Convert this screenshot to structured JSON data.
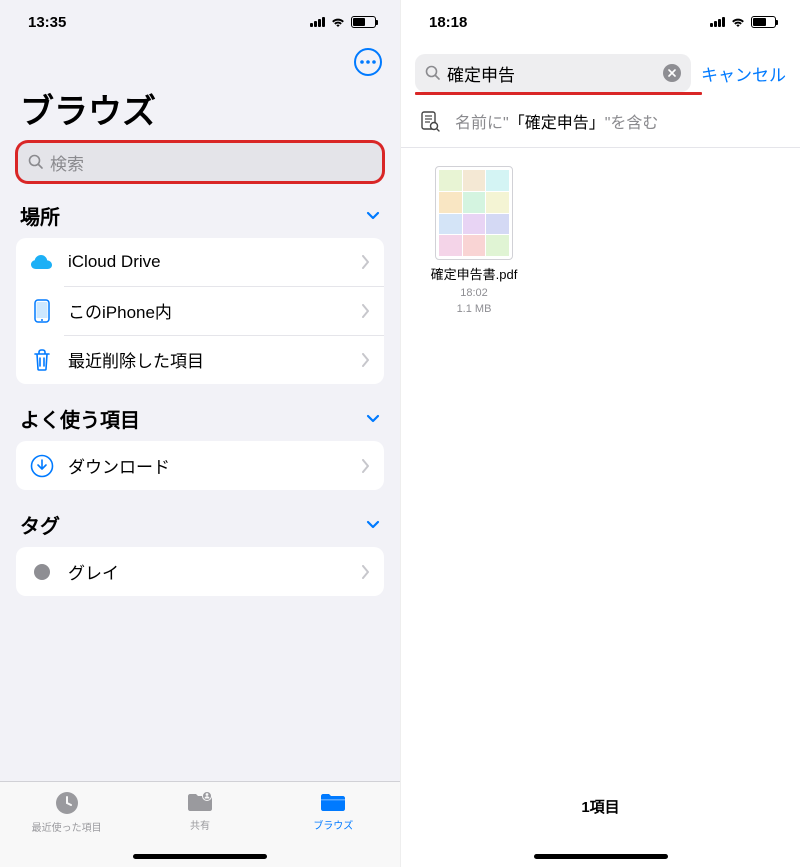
{
  "left": {
    "status_time": "13:35",
    "battery_percent": 55,
    "title": "ブラウズ",
    "search_placeholder": "検索",
    "sections": {
      "locations": {
        "title": "場所",
        "items": [
          {
            "label": "iCloud Drive",
            "icon": "cloud"
          },
          {
            "label": "このiPhone内",
            "icon": "phone"
          },
          {
            "label": "最近削除した項目",
            "icon": "trash"
          }
        ]
      },
      "favorites": {
        "title": "よく使う項目",
        "items": [
          {
            "label": "ダウンロード",
            "icon": "download"
          }
        ]
      },
      "tags": {
        "title": "タグ",
        "items": [
          {
            "label": "グレイ",
            "icon": "gray-dot"
          }
        ]
      }
    },
    "tabs": [
      {
        "label": "最近使った項目",
        "active": false
      },
      {
        "label": "共有",
        "active": false
      },
      {
        "label": "ブラウズ",
        "active": true
      }
    ]
  },
  "right": {
    "status_time": "18:18",
    "battery_percent": 60,
    "search_value": "確定申告",
    "cancel_label": "キャンセル",
    "suggest_prefix": "名前に\"",
    "suggest_term": "「確定申告」",
    "suggest_suffix": "\"を含む",
    "file": {
      "name": "確定申告書.pdf",
      "time": "18:02",
      "size": "1.1 MB"
    },
    "footer_count": "1項目"
  }
}
